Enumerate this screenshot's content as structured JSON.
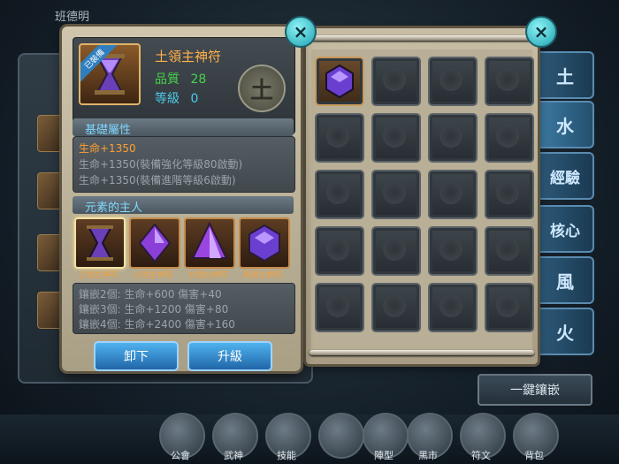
{
  "background": {
    "player_name": "班德明",
    "onekey_button": "一鍵鑲嵌",
    "bottom_nav": [
      "公會",
      "武神",
      "技能",
      "",
      "陣型",
      "黑市",
      "符文",
      "背包"
    ]
  },
  "item": {
    "name": "土領主神符",
    "equipped_tag": "已裝備",
    "quality_label": "品質",
    "quality_value": "28",
    "level_label": "等級",
    "level_value": "0",
    "element_glyph": "土"
  },
  "basic_attrs": {
    "title": "基礎屬性",
    "lines": [
      "生命+1350",
      "生命+1350(裝備強化等級80啟動)",
      "生命+1350(裝備進階等級6啟動)"
    ]
  },
  "element_lord": {
    "title": "元素的主人",
    "gems": [
      {
        "name": "土領主神符",
        "color": "#7a3fd0"
      },
      {
        "name": "火領主神符",
        "color": "#8a3fd8"
      },
      {
        "name": "水領主神符",
        "color": "#9a45e0"
      },
      {
        "name": "風領主神符",
        "color": "#6a3fd0"
      }
    ],
    "set_bonus": [
      "鑲嵌2個: 生命+600 傷害+40",
      "鑲嵌3個: 生命+1200 傷害+80",
      "鑲嵌4個: 生命+2400 傷害+160"
    ]
  },
  "buttons": {
    "unequip": "卸下",
    "upgrade": "升級"
  },
  "close_icon": "×",
  "side_tabs": [
    "土",
    "水",
    "經驗",
    "核心",
    "風",
    "火"
  ],
  "grid": {
    "rows": 5,
    "cols": 4,
    "filled_index": 0
  }
}
